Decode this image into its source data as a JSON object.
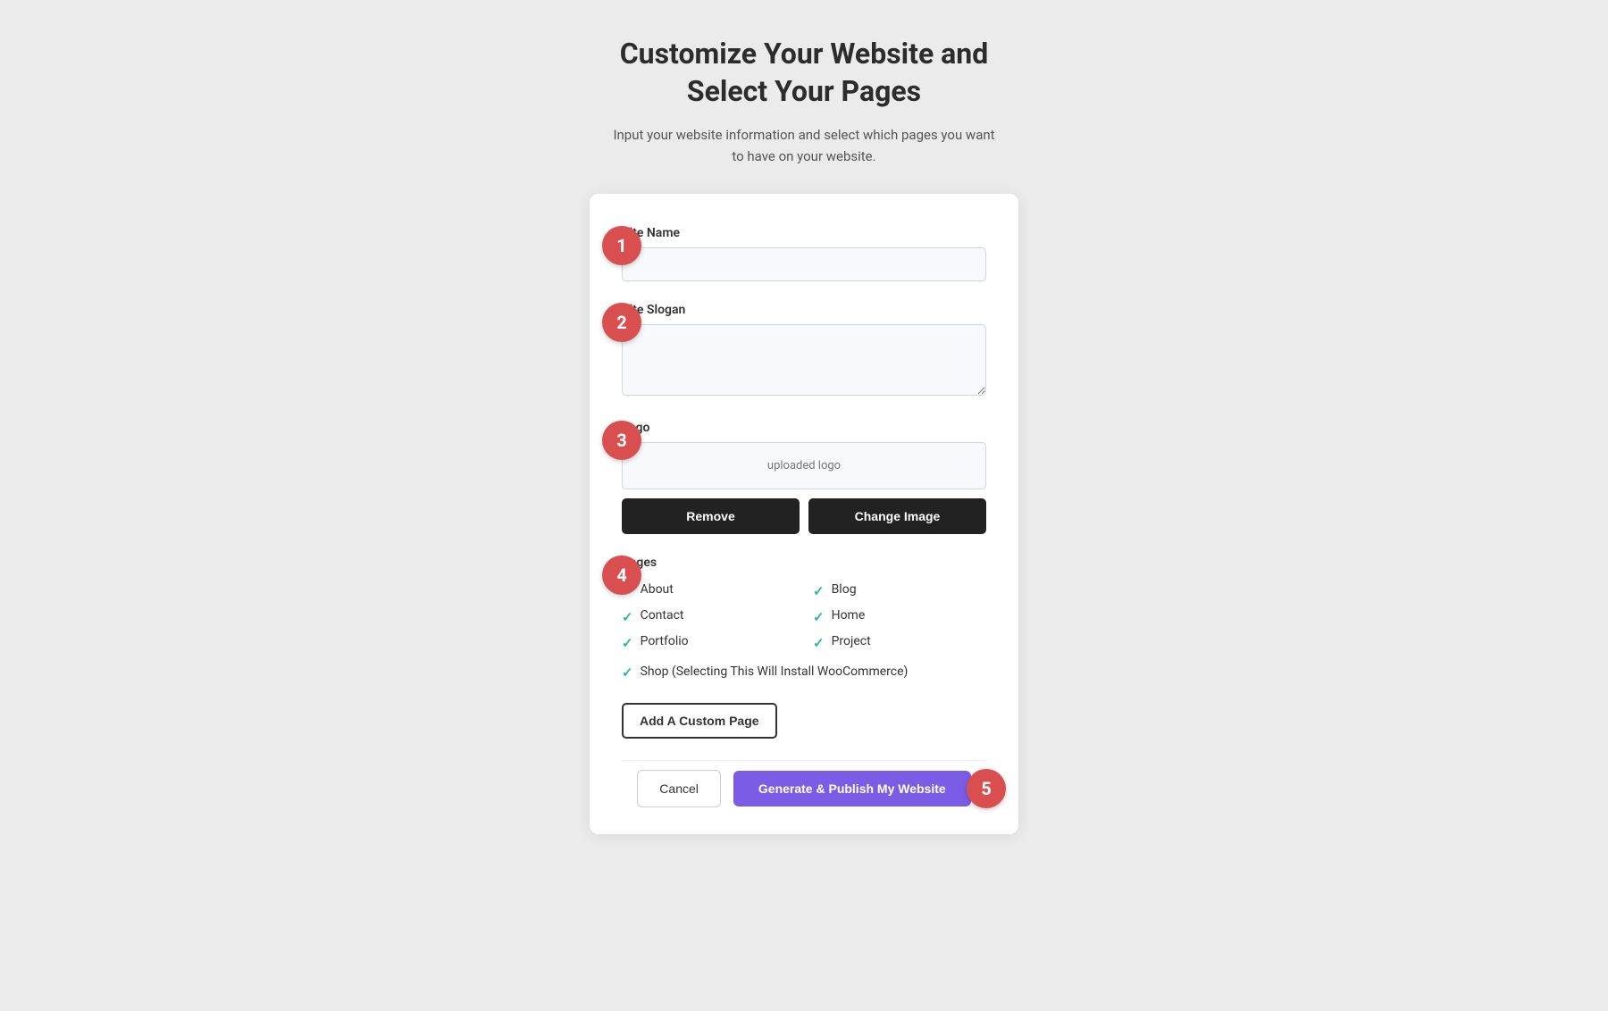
{
  "header": {
    "title_line1": "Customize Your Website and",
    "title_line2": "Select Your Pages",
    "subtitle": "Input your website information and select which pages you want to have on your website."
  },
  "steps": {
    "step1": "1",
    "step2": "2",
    "step3": "3",
    "step4": "4",
    "step5": "5"
  },
  "form": {
    "site_name_label": "Site Name",
    "site_name_placeholder": "",
    "site_slogan_label": "Site Slogan",
    "site_slogan_placeholder": "",
    "logo_label": "Logo",
    "logo_preview_text": "uploaded logo",
    "remove_button": "Remove",
    "change_image_button": "Change Image",
    "pages_label": "Pages",
    "pages": [
      {
        "name": "About",
        "checked": true
      },
      {
        "name": "Blog",
        "checked": true
      },
      {
        "name": "Contact",
        "checked": true
      },
      {
        "name": "Home",
        "checked": true
      },
      {
        "name": "Portfolio",
        "checked": true
      },
      {
        "name": "Project",
        "checked": true
      }
    ],
    "shop_page": "Shop (Selecting This Will Install WooCommerce)",
    "shop_checked": true,
    "add_custom_page_button": "Add A Custom Page",
    "cancel_button": "Cancel",
    "publish_button": "Generate & Publish My Website"
  },
  "colors": {
    "step_badge_bg": "#d94f4f",
    "publish_btn_bg": "#7b5ce7",
    "check_color": "#2bb89a",
    "dark_btn": "#222"
  }
}
